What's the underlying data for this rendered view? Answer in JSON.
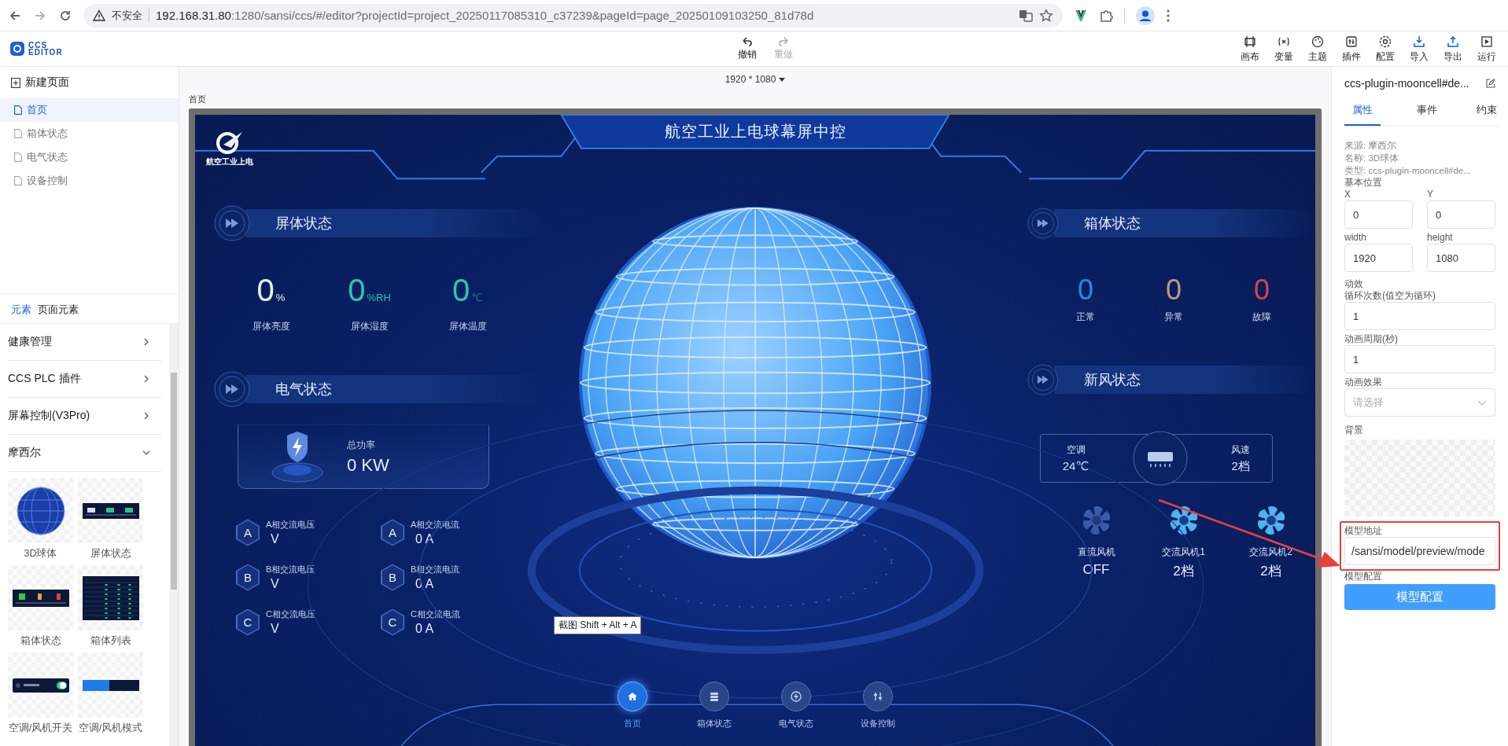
{
  "browser": {
    "security_label": "不安全",
    "url_host": "192.168.31.80",
    "url_path": ":1280/sansi/ccs/#/editor?projectId=project_20250117085310_c37239&pageId=page_20250109103250_81d78d"
  },
  "app_toolbar": {
    "logo_top": "CCS",
    "logo_bottom": "EDITOR",
    "history": [
      {
        "label": "撤销",
        "disabled": false
      },
      {
        "label": "重做",
        "disabled": true
      }
    ],
    "tools": [
      "画布",
      "变量",
      "主题",
      "插件",
      "配置",
      "导入",
      "导出",
      "运行"
    ]
  },
  "pages_panel": {
    "new_page": "新建页面",
    "pages": [
      {
        "label": "首页",
        "selected": true
      },
      {
        "label": "箱体状态",
        "selected": false
      },
      {
        "label": "电气状态",
        "selected": false
      },
      {
        "label": "设备控制",
        "selected": false
      }
    ]
  },
  "elements_panel": {
    "tabs": [
      {
        "label": "元素",
        "selected": true
      },
      {
        "label": "页面元素",
        "selected": false
      }
    ],
    "categories": [
      {
        "label": "健康管理",
        "expanded": false
      },
      {
        "label": "CCS PLC 插件",
        "expanded": false
      },
      {
        "label": "屏幕控制(V3Pro)",
        "expanded": false
      },
      {
        "label": "摩西尔",
        "expanded": true,
        "items": [
          {
            "label": "3D球体",
            "kind": "sphere"
          },
          {
            "label": "屏体状态",
            "kind": "metrics"
          },
          {
            "label": "箱体状态",
            "kind": "counts"
          },
          {
            "label": "箱体列表",
            "kind": "table"
          },
          {
            "label": "空调/风机开关",
            "kind": "switch"
          },
          {
            "label": "空调/风机模式",
            "kind": "mode"
          }
        ]
      }
    ]
  },
  "canvas": {
    "resolution": "1920 * 1080",
    "page_label": "首页",
    "dashboard": {
      "title": "航空工业上电球幕屏中控",
      "logo_caption": "航空工业上电",
      "screen_status": {
        "heading": "屏体状态",
        "metrics": [
          {
            "value": "0",
            "unit": "%",
            "label": "屏体亮度",
            "color": "#e8eef8"
          },
          {
            "value": "0",
            "unit": "%RH",
            "label": "屏体湿度",
            "color": "#2cc4b4"
          },
          {
            "value": "0",
            "unit": "℃",
            "label": "屏体温度",
            "color": "#2cc4b4"
          }
        ]
      },
      "electrical": {
        "heading": "电气状态",
        "power_label": "总功率",
        "power_value": "0 KW",
        "phases": [
          {
            "badge": "A",
            "label": "A相交流电压",
            "value": "V"
          },
          {
            "badge": "A",
            "label": "A相交流电流",
            "value": "0 A"
          },
          {
            "badge": "B",
            "label": "B相交流电压",
            "value": "V"
          },
          {
            "badge": "B",
            "label": "B相交流电流",
            "value": "0 A"
          },
          {
            "badge": "C",
            "label": "C相交流电压",
            "value": "V"
          },
          {
            "badge": "C",
            "label": "C相交流电流",
            "value": "0 A"
          }
        ]
      },
      "box_status": {
        "heading": "箱体状态",
        "counts": [
          {
            "value": "0",
            "label": "正常",
            "color": "#2a8ad8"
          },
          {
            "value": "0",
            "label": "异常",
            "color": "#b89a80"
          },
          {
            "value": "0",
            "label": "故障",
            "color": "#d0454f"
          }
        ]
      },
      "fresh_air": {
        "heading": "新风状态",
        "ac_label": "空调",
        "ac_value": "24℃",
        "speed_label": "风速",
        "speed_value": "2档",
        "fans": [
          {
            "label": "直流风机",
            "value": "OFF",
            "on": false
          },
          {
            "label": "交流风机1",
            "value": "2档",
            "on": true
          },
          {
            "label": "交流风机2",
            "value": "2档",
            "on": true
          }
        ]
      },
      "nav": [
        {
          "label": "首页",
          "selected": true
        },
        {
          "label": "箱体状态",
          "selected": false
        },
        {
          "label": "电气状态",
          "selected": false
        },
        {
          "label": "设备控制",
          "selected": false
        }
      ]
    },
    "tooltip": "截图 Shift + Alt + A"
  },
  "properties": {
    "title": "ccs-plugin-mooncell#de...",
    "tabs": [
      {
        "label": "属性",
        "selected": true
      },
      {
        "label": "事件",
        "selected": false
      },
      {
        "label": "约束",
        "selected": false
      }
    ],
    "info": [
      "来源: 摩西尔",
      "名称: 3D球体",
      "类型: ccs-plugin-mooncell#de..."
    ],
    "position_heading": "基本位置",
    "fields": [
      {
        "label": "X",
        "value": "0"
      },
      {
        "label": "Y",
        "value": "0"
      },
      {
        "label": "width",
        "value": "1920"
      },
      {
        "label": "height",
        "value": "1080"
      }
    ],
    "animation_heading": "动效",
    "loop_label": "循环次数(值空为循环)",
    "loop_value": "1",
    "period_label": "动画周期(秒)",
    "period_value": "1",
    "effect_label": "动画效果",
    "effect_placeholder": "请选择",
    "background_label": "背景",
    "model_url_label": "模型地址",
    "model_url_value": "/sansi/model/preview/mode",
    "model_config_label": "模型配置",
    "model_config_button": "模型配置"
  }
}
